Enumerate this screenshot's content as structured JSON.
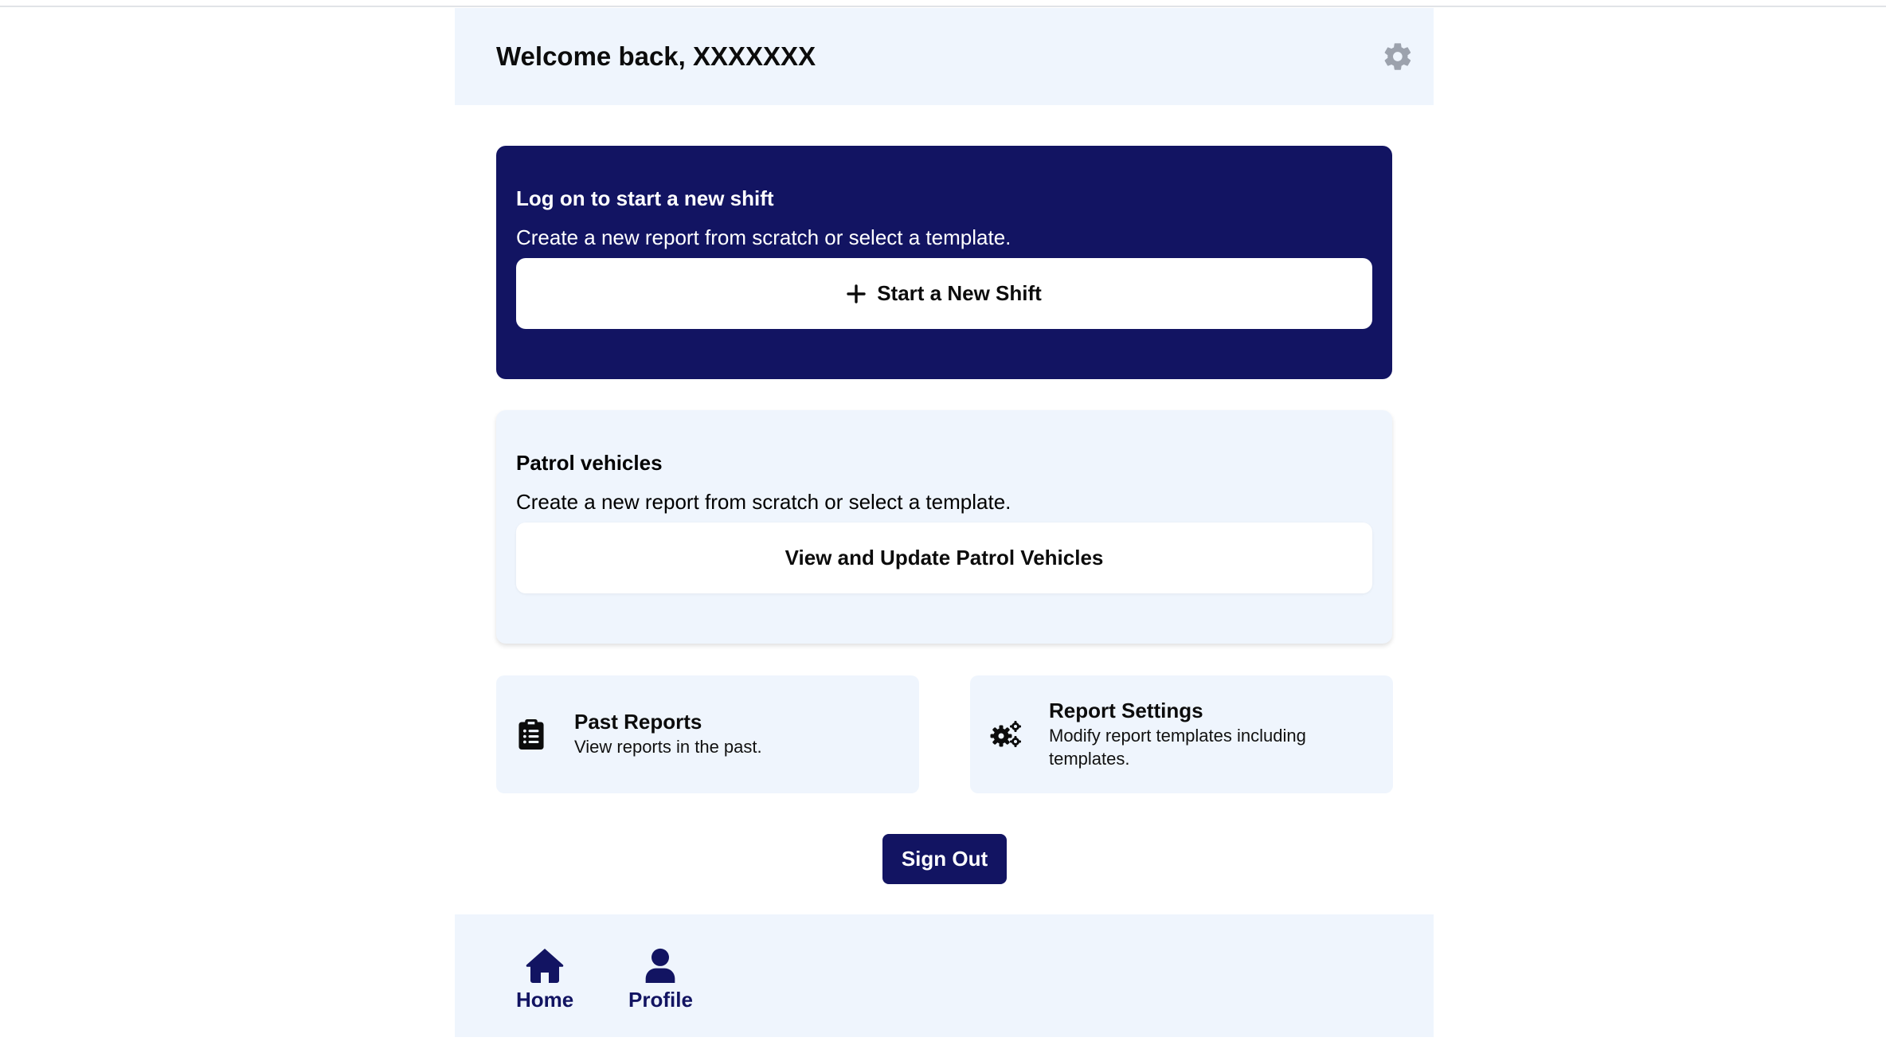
{
  "header": {
    "title": "Welcome back, XXXXXXX",
    "settings_icon": "gear-icon"
  },
  "shift_card": {
    "title": "Log on to start a new shift",
    "description": "Create a new report from scratch or select a template.",
    "button_label": "Start a New Shift",
    "button_icon": "plus-icon",
    "background_color": "#121462"
  },
  "vehicle_card": {
    "title": "Patrol vehicles",
    "description": "Create a new report from scratch or select a template.",
    "button_label": "View and Update Patrol Vehicles",
    "background_color": "#eff5fd"
  },
  "tiles": [
    {
      "icon": "clipboard-list-icon",
      "title": "Past Reports",
      "description": "View reports in the past."
    },
    {
      "icon": "gears-icon",
      "title": "Report Settings",
      "description": "Modify report templates including templates."
    }
  ],
  "sign_out_label": "Sign Out",
  "bottom_nav": {
    "items": [
      {
        "icon": "home-icon",
        "label": "Home"
      },
      {
        "icon": "user-icon",
        "label": "Profile"
      }
    ]
  },
  "colors": {
    "accent": "#121462",
    "panel": "#eff5fd"
  }
}
